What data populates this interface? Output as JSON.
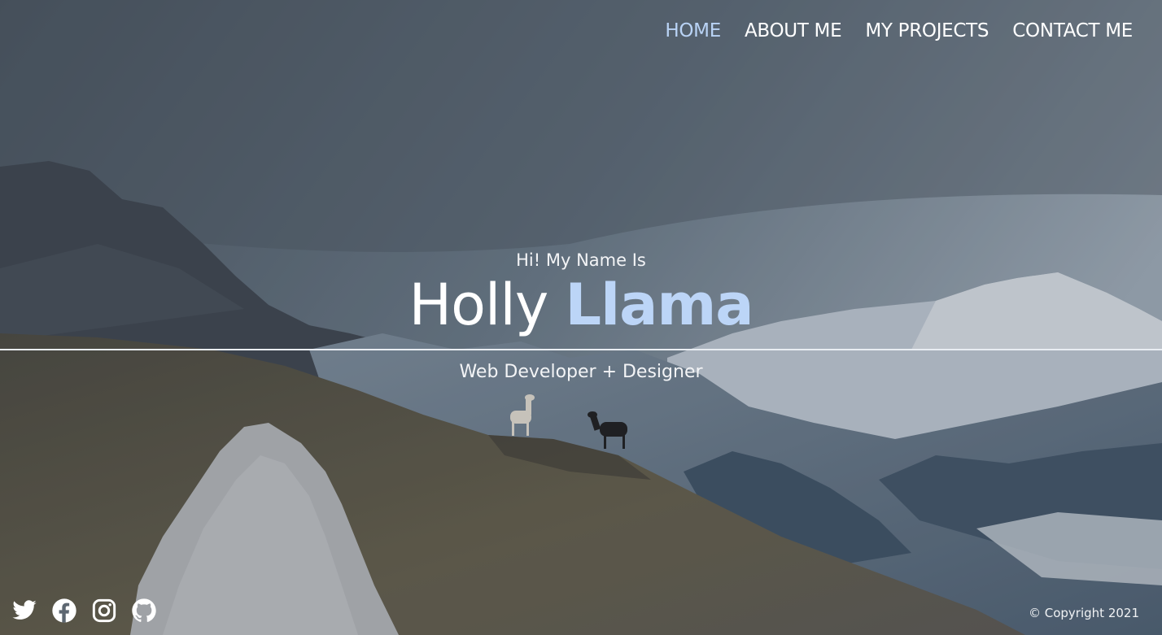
{
  "nav": {
    "items": [
      {
        "label": "HOME",
        "active": true
      },
      {
        "label": "ABOUT ME",
        "active": false
      },
      {
        "label": "MY PROJECTS",
        "active": false
      },
      {
        "label": "CONTACT ME",
        "active": false
      }
    ],
    "active_color": "#b9d3f5"
  },
  "hero": {
    "greeting": "Hi! My Name Is",
    "first_name": "Holly",
    "last_name": "Llama",
    "tagline": "Web Developer + Designer",
    "accent_color": "#bcd5f7"
  },
  "social": {
    "icons": [
      "twitter-icon",
      "facebook-icon",
      "instagram-icon",
      "github-icon"
    ]
  },
  "footer": {
    "copyright": "© Copyright 2021"
  }
}
